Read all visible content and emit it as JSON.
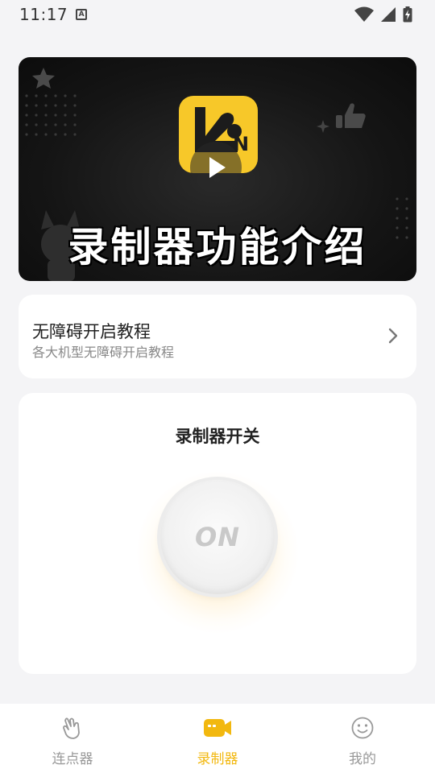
{
  "status_bar": {
    "time": "11:17",
    "notification_icon": "a-box-icon",
    "icons": [
      "wifi-icon",
      "signal-icon",
      "battery-icon"
    ]
  },
  "video_banner": {
    "title": "录制器功能介绍",
    "app_logo_icon": "app-logo-icon",
    "play_icon": "play-icon",
    "logo_text": "N"
  },
  "tutorial_card": {
    "title": "无障碍开启教程",
    "subtitle": "各大机型无障碍开启教程",
    "chevron_icon": "chevron-right-icon"
  },
  "recorder_card": {
    "title": "录制器开关",
    "toggle_label": "ON"
  },
  "bottom_nav": {
    "items": [
      {
        "label": "连点器",
        "icon": "hand-tap-icon",
        "active": false
      },
      {
        "label": "录制器",
        "icon": "video-camera-icon",
        "active": true
      },
      {
        "label": "我的",
        "icon": "smile-face-icon",
        "active": false
      }
    ]
  },
  "colors": {
    "accent": "#f2b80f",
    "background": "#f4f4f6",
    "card": "#ffffff",
    "inactive_text": "#999999"
  }
}
